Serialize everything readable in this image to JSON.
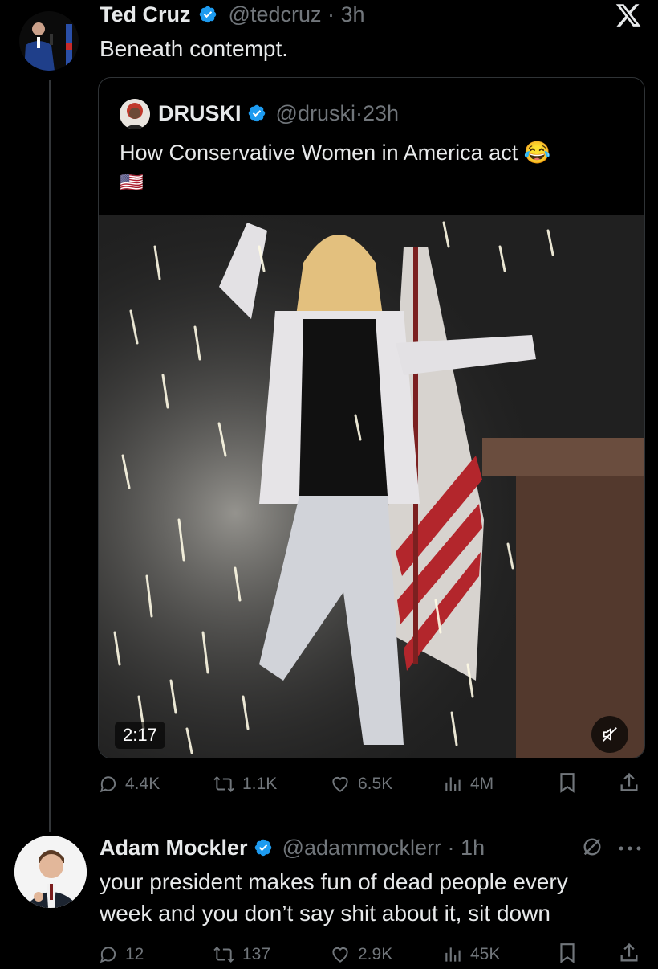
{
  "main_tweet": {
    "author_name": "Ted Cruz",
    "handle": "@tedcruz",
    "time": "3h",
    "text": "Beneath contempt."
  },
  "quoted_tweet": {
    "author_name": "DRUSKI",
    "handle": "@druski",
    "time": "23h",
    "text": "How Conservative Women in America act 😂",
    "text_line2": "🇺🇸",
    "video_duration": "2:17"
  },
  "main_actions": {
    "replies": "4.4K",
    "reposts": "1.1K",
    "likes": "6.5K",
    "views": "4M"
  },
  "reply_tweet": {
    "author_name": "Adam Mockler",
    "handle": "@adammocklerr",
    "time": "1h",
    "text_line1": "your president makes fun of dead people every",
    "text_line2": "week and you don’t say shit about it, sit down"
  },
  "reply_actions": {
    "replies": "12",
    "reposts": "137",
    "likes": "2.9K",
    "views": "45K"
  },
  "icons": {
    "x_logo": "x-logo-icon",
    "verified": "verified-badge-icon",
    "reply": "reply-icon",
    "repost": "repost-icon",
    "like": "heart-icon",
    "views": "views-icon",
    "bookmark": "bookmark-icon",
    "share": "share-icon",
    "mute": "mute-icon",
    "more": "more-icon",
    "grok": "grok-icon"
  },
  "colors": {
    "background": "#000000",
    "text": "#e7e9ea",
    "secondary": "#71767b",
    "verified": "#1d9bf0"
  }
}
